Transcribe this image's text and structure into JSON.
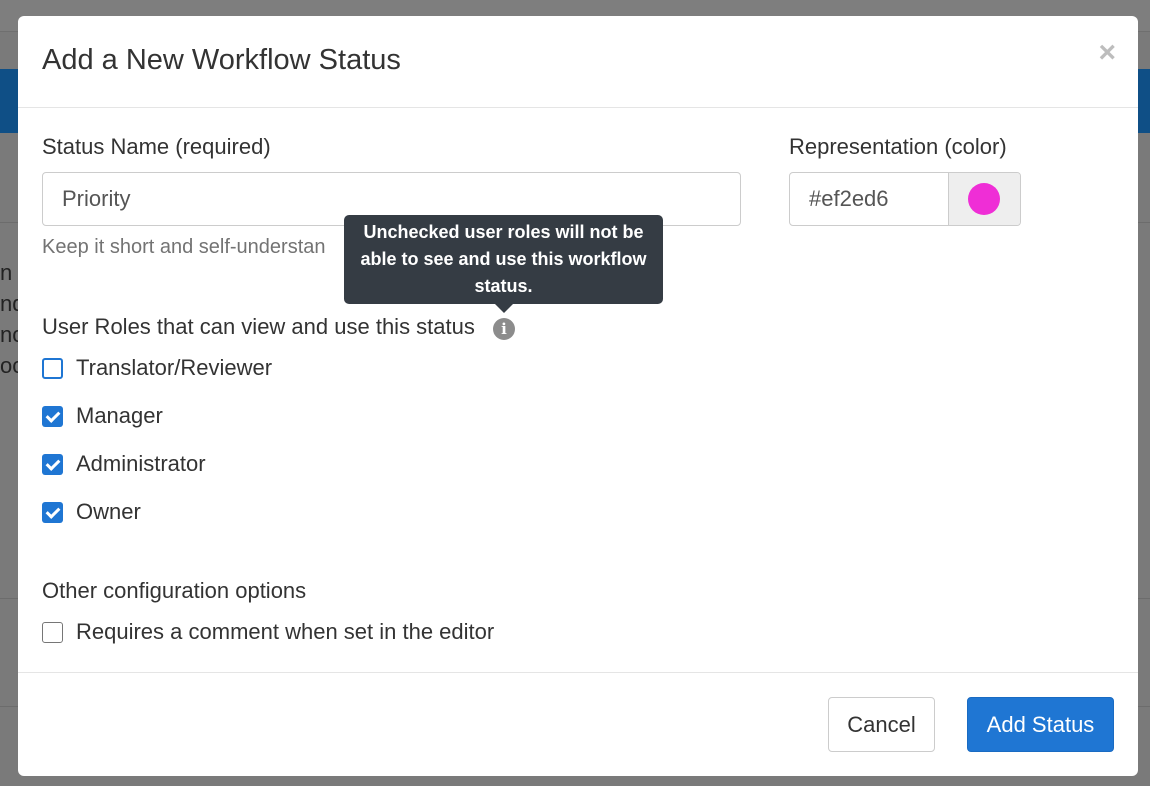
{
  "background": {
    "fragments": [
      "n",
      "nd",
      "nc",
      "oc"
    ]
  },
  "modal": {
    "title": "Add a New Workflow Status",
    "close_label": "×"
  },
  "form": {
    "status_name": {
      "label": "Status Name (required)",
      "value": "Priority",
      "help": "Keep it short and self-understan"
    },
    "color": {
      "label": "Representation (color)",
      "value": "#ef2ed6",
      "swatch": "#ef2ed6"
    },
    "roles": {
      "label": "User Roles that can view and use this status",
      "info_icon": "info-icon",
      "tooltip": "Unchecked user roles will not be able to see and use this workflow status.",
      "items": [
        {
          "label": "Translator/Reviewer",
          "checked": false
        },
        {
          "label": "Manager",
          "checked": true
        },
        {
          "label": "Administrator",
          "checked": true
        },
        {
          "label": "Owner",
          "checked": true
        }
      ]
    },
    "other": {
      "label": "Other configuration options",
      "items": [
        {
          "label": "Requires a comment when set in the editor",
          "checked": false
        }
      ]
    }
  },
  "footer": {
    "cancel_label": "Cancel",
    "submit_label": "Add Status"
  },
  "colors": {
    "primary": "#1f76d3",
    "tooltip_bg": "#353c44",
    "swatch": "#ef2ed6"
  }
}
